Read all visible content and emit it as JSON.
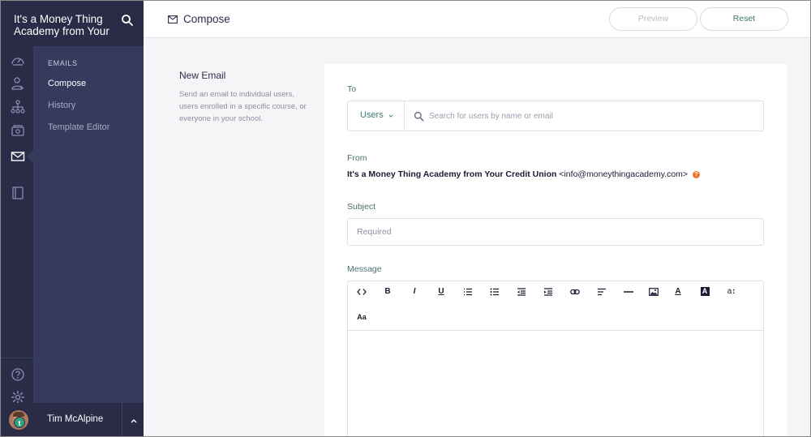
{
  "sidebar": {
    "school_name": "It's a Money Thing Academy from Your",
    "rail_icons": [
      "dashboard-icon",
      "users-icon",
      "sitemap-icon",
      "money-icon",
      "mail-icon",
      "book-icon",
      "help-circle-icon",
      "settings-icon"
    ],
    "submenu": {
      "title": "EMAILS",
      "items": [
        {
          "label": "Compose",
          "active": true
        },
        {
          "label": "History",
          "active": false
        },
        {
          "label": "Template Editor",
          "active": false
        }
      ]
    },
    "user": {
      "name": "Tim McAlpine",
      "avatar_badge": "t"
    }
  },
  "header": {
    "title": "Compose",
    "preview_label": "Preview",
    "reset_label": "Reset"
  },
  "section": {
    "title": "New Email",
    "description": "Send an email to individual users, users enrolled in a specific course, or everyone in your school."
  },
  "form": {
    "to_label": "To",
    "to_type": "Users",
    "to_placeholder": "Search for users by name or email",
    "from_label": "From",
    "from_name": "It's a Money Thing Academy from Your Credit Union",
    "from_email": "<info@moneythingacademy.com>",
    "subject_label": "Subject",
    "subject_placeholder": "Required",
    "message_label": "Message",
    "toolbar": [
      "code-icon",
      "bold-icon",
      "italic-icon",
      "underline-icon",
      "ordered-list-icon",
      "bullet-list-icon",
      "outdent-icon",
      "indent-icon",
      "link-icon",
      "align-icon",
      "horizontal-rule-icon",
      "image-icon",
      "text-color-icon",
      "background-color-icon",
      "font-size-icon",
      "font-family-icon"
    ],
    "toolbar_text": {
      "bold": "B",
      "italic": "I",
      "underline": "U",
      "text_color": "A",
      "bg_color": "A",
      "font_size": "a↕",
      "font_family": "Aa"
    }
  },
  "colors": {
    "sidebar_dark": "#2a2c47",
    "sidebar": "#363a5d",
    "accent": "#3d7a74",
    "help": "#f0762a"
  }
}
